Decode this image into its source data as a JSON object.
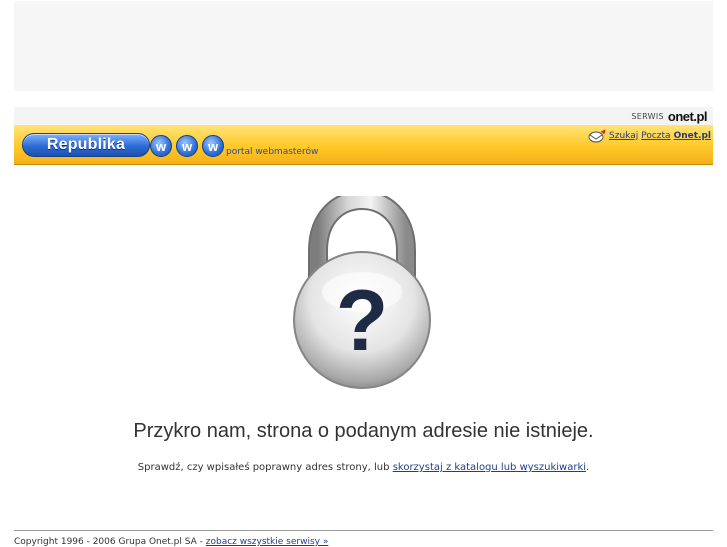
{
  "header": {
    "serwis_label": "SERWIS",
    "onet_logo": "onet.pl",
    "logo_text": "Republika",
    "www_letters": [
      "w",
      "w",
      "w"
    ],
    "portal_text": "portal webmasterów",
    "links": {
      "szukaj": "Szukaj",
      "poczta": "Poczta",
      "onet": "Onet.pl"
    }
  },
  "main": {
    "lock_icon": "padlock-question-icon",
    "message": "Przykro nam, strona o podanym adresie nie istnieje.",
    "sub_prefix": "Sprawdź, czy wpisałeś poprawny adres strony, lub ",
    "sub_link": "skorzystaj z katalogu lub wyszukiwarki",
    "sub_suffix": "."
  },
  "footer": {
    "copyright": "Copyright 1996 - 2006 Grupa Onet.pl SA - ",
    "services_link": "zobacz wszystkie serwisy »"
  }
}
